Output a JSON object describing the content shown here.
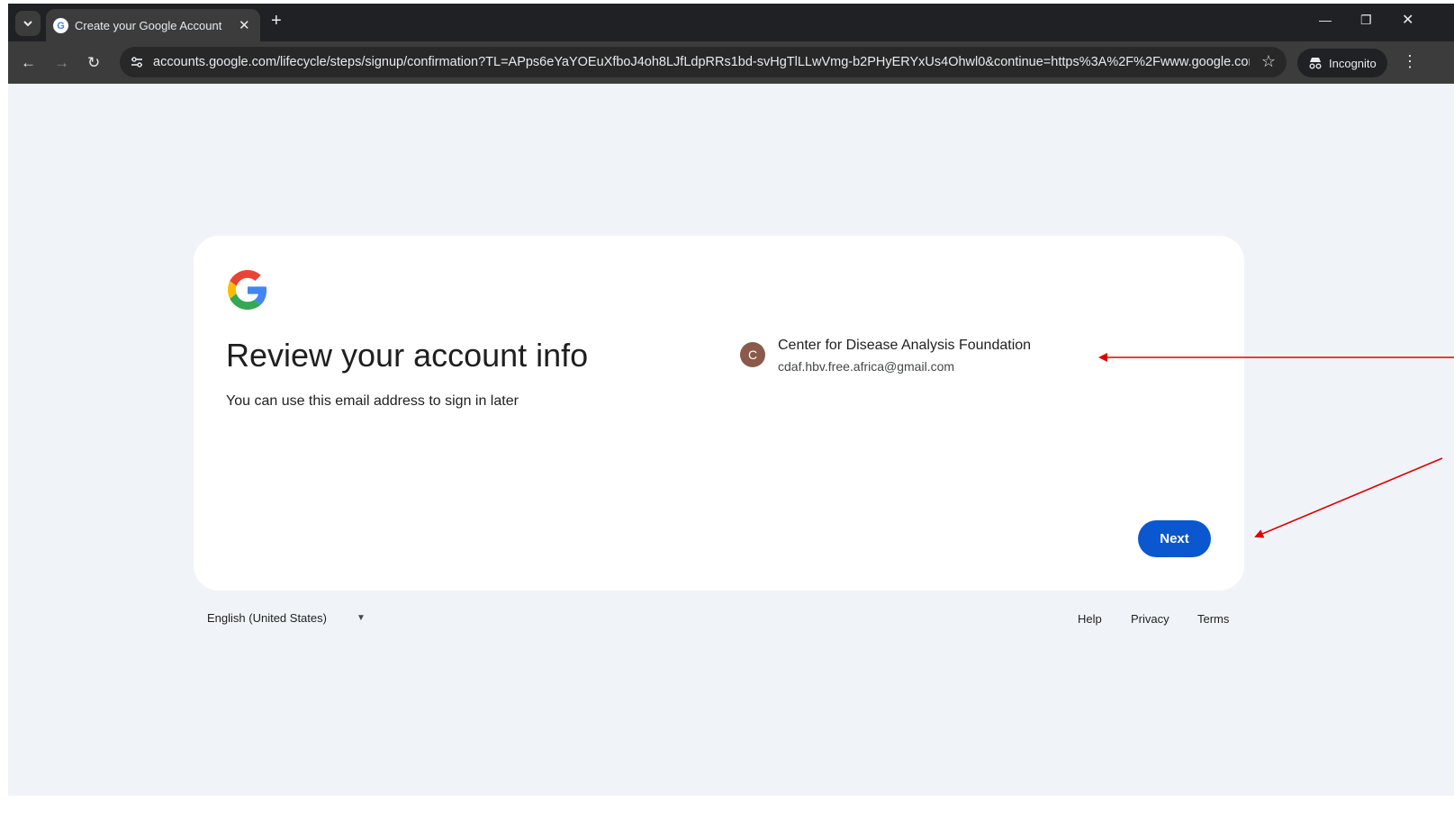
{
  "browser": {
    "tab_title": "Create your Google Account",
    "new_tab_symbol": "+",
    "url": "accounts.google.com/lifecycle/steps/signup/confirmation?TL=APps6eYaYOEuXfboJ4oh8LJfLdpRRs1bd-svHgTlLLwVmg-b2PHyERYxUs4Ohwl0&continue=https%3A%2F%2Fwww.google.com%...",
    "incognito_label": "Incognito"
  },
  "card": {
    "heading": "Review your account info",
    "subtext": "You can use this email address to sign in later",
    "account": {
      "avatar_letter": "C",
      "name": "Center for Disease Analysis Foundation",
      "email": "cdaf.hbv.free.africa@gmail.com"
    },
    "next_label": "Next"
  },
  "footer": {
    "language": "English (United States)",
    "links": [
      "Help",
      "Privacy",
      "Terms"
    ]
  },
  "colors": {
    "primary_button": "#0b57d0",
    "avatar": "#8a5b4a",
    "annotation_arrow": "#e00000",
    "page_background": "#f0f4f9"
  },
  "icons": [
    "chevron-down-icon",
    "google-favicon-icon",
    "close-icon",
    "minimize-icon",
    "restore-icon",
    "back-icon",
    "forward-icon",
    "reload-icon",
    "site-info-icon",
    "star-icon",
    "incognito-icon",
    "more-menu-icon",
    "google-logo-icon",
    "caret-down-icon"
  ]
}
